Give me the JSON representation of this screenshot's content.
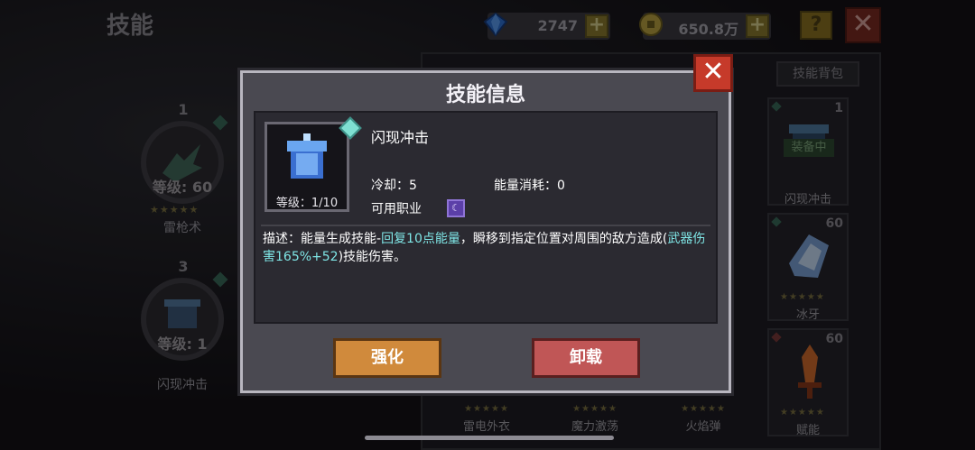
{
  "page": {
    "title": "技能",
    "gems": "2747",
    "gold": "650.8万",
    "help": "?",
    "close": "✕"
  },
  "left_slots": [
    {
      "num": "1",
      "level": "等级: 60",
      "stars": "★★★★★",
      "name": "雷枪术"
    },
    {
      "num": "3",
      "level": "等级: 1",
      "stars": "",
      "name": "闪现冲击"
    }
  ],
  "right_panel": {
    "bag_tab": "技能背包",
    "cards": [
      {
        "num": "1",
        "name": "闪现冲击",
        "badge": "装备中",
        "stars": ""
      },
      {
        "num": "60",
        "name": "冰牙",
        "badge": "",
        "stars": "★★★★★"
      },
      {
        "num": "60",
        "name": "赋能",
        "badge": "",
        "stars": "★★★★★"
      }
    ],
    "bottom": [
      {
        "name": "雷电外衣",
        "stars": "★★★★★"
      },
      {
        "name": "魔力激荡",
        "stars": "★★★★★"
      },
      {
        "name": "火焰弹",
        "stars": "★★★★★"
      }
    ]
  },
  "dialog": {
    "title": "技能信息",
    "close": "✕",
    "skill_name": "闪现冲击",
    "level": "等级：1/10",
    "cooldown": "冷却：5",
    "energy": "能量消耗：0",
    "class_label": "可用职业",
    "desc_a": "描述：能量生成技能-",
    "desc_hl1": "回复10点能量",
    "desc_b": "，瞬移到指定位置对周围的敌方造成(",
    "desc_hl2": "武器伤害165%+52",
    "desc_c": ")技能伤害。",
    "btn_upgrade": "强化",
    "btn_unequip": "卸载"
  },
  "colors": {
    "accent_highlight": "#7fe6e6",
    "upgrade_button": "#d08a3c",
    "unequip_button": "#c05656",
    "close_button": "#c63a2a"
  }
}
